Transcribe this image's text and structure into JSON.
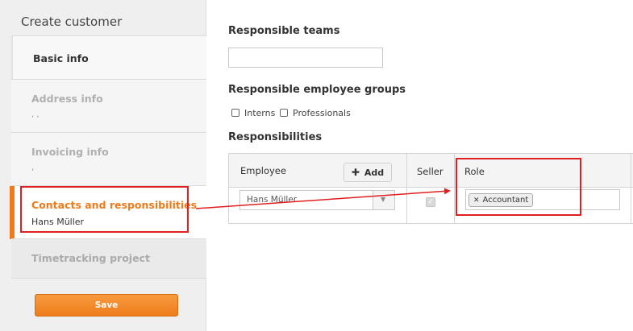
{
  "sidebar": {
    "title": "Create customer",
    "steps": [
      {
        "label": "Basic info",
        "sub": ""
      },
      {
        "label": "Address info",
        "sub": ", ,"
      },
      {
        "label": "Invoicing info",
        "sub": ","
      },
      {
        "label": "Contacts and responsibilities",
        "sub": "Hans Müller"
      },
      {
        "label": "Timetracking project",
        "sub": ""
      }
    ],
    "save_label": "Save"
  },
  "main": {
    "teams_title": "Responsible teams",
    "teams_value": "",
    "groups_title": "Responsible employee groups",
    "groups": [
      {
        "label": "Interns",
        "checked": false
      },
      {
        "label": "Professionals",
        "checked": false
      }
    ],
    "responsibilities_title": "Responsibilities",
    "table": {
      "headers": {
        "employee": "Employee",
        "seller": "Seller",
        "role": "Role"
      },
      "add_label": "Add",
      "rows": [
        {
          "employee": "Hans Müller",
          "seller": true,
          "role_tag": "Accountant"
        }
      ]
    }
  },
  "colors": {
    "accent": "#ee7a1a",
    "highlight": "#e02020"
  },
  "icons": {
    "add": "plus-icon",
    "dropdown": "chevron-down-icon",
    "remove_tag": "close-icon",
    "seller_check": "check-icon"
  }
}
